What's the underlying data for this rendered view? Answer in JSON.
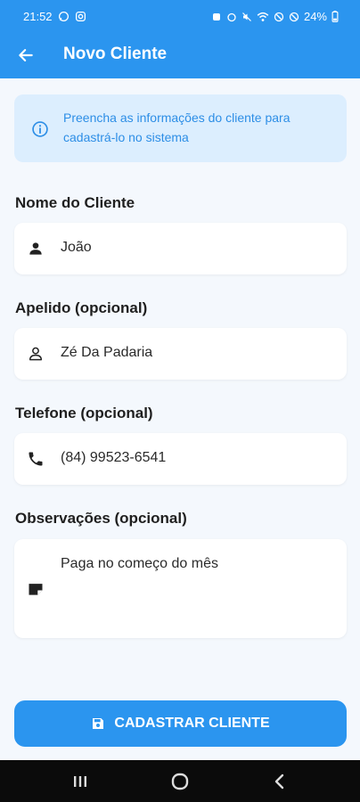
{
  "status_bar": {
    "time": "21:52",
    "left_icons": [
      "whatsapp-icon",
      "instagram-icon"
    ],
    "right_icons": [
      "notification-icon",
      "alarm-icon",
      "mute-icon",
      "wifi-icon",
      "dnd-icon",
      "no-signal-icon"
    ],
    "battery": "24%"
  },
  "app_bar": {
    "title": "Novo Cliente",
    "back_icon": "arrow-left-icon"
  },
  "info": {
    "icon": "info-icon",
    "text": "Preencha as informações do cliente para cadastrá-lo no sistema"
  },
  "fields": {
    "name": {
      "label": "Nome do Cliente",
      "value": "João",
      "icon": "person-filled-icon"
    },
    "nickname": {
      "label": "Apelido (opcional)",
      "value": "Zé Da Padaria",
      "icon": "person-outline-icon"
    },
    "phone": {
      "label": "Telefone (opcional)",
      "value": "(84) 99523-6541",
      "icon": "phone-icon"
    },
    "notes": {
      "label": "Observações (opcional)",
      "value": "Paga no começo do mês",
      "icon": "note-icon"
    }
  },
  "submit": {
    "label": "CADASTRAR CLIENTE",
    "icon": "save-icon"
  },
  "nav": {
    "recents_icon": "recents-icon",
    "home_icon": "home-icon",
    "back_icon": "nav-back-icon"
  },
  "colors": {
    "primary": "#2b95ef",
    "info_bg": "#dceefe",
    "info_text": "#2d8ee6",
    "background": "#f4f8fd"
  }
}
